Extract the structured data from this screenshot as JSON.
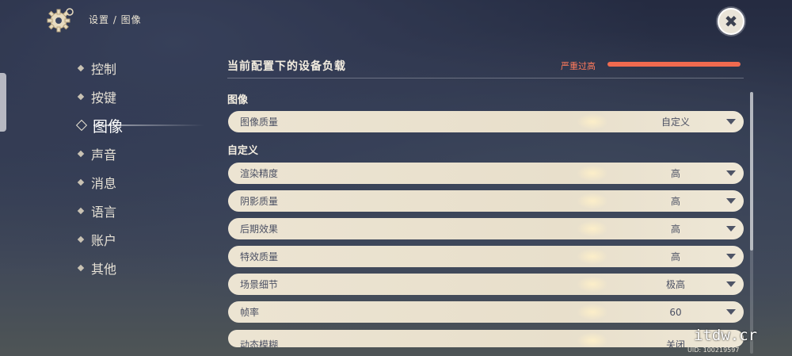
{
  "header": {
    "breadcrumb": "设置 / 图像",
    "settings_icon": "gear-icon",
    "close_icon": "close-icon"
  },
  "nav": {
    "items": [
      {
        "label": "控制",
        "active": false
      },
      {
        "label": "按键",
        "active": false
      },
      {
        "label": "图像",
        "active": true
      },
      {
        "label": "声音",
        "active": false
      },
      {
        "label": "消息",
        "active": false
      },
      {
        "label": "语言",
        "active": false
      },
      {
        "label": "账户",
        "active": false
      },
      {
        "label": "其他",
        "active": false
      }
    ]
  },
  "load": {
    "title": "当前配置下的设备负载",
    "status": "严重过高",
    "status_color": "#ff7a5c",
    "level": 1.0
  },
  "sections": {
    "image": "图像",
    "custom": "自定义"
  },
  "settings": {
    "quality": {
      "label": "图像质量",
      "value": "自定义"
    },
    "render": {
      "label": "渲染精度",
      "value": "高"
    },
    "shadow": {
      "label": "阴影质量",
      "value": "高"
    },
    "post": {
      "label": "后期效果",
      "value": "高"
    },
    "effects": {
      "label": "特效质量",
      "value": "高"
    },
    "scene": {
      "label": "场景细节",
      "value": "极高"
    },
    "fps": {
      "label": "帧率",
      "value": "60"
    },
    "motion_blur": {
      "label": "动态模糊",
      "value": "关闭"
    }
  },
  "footer": {
    "uid": "UID: 100219597",
    "watermark": "itdw.cr"
  }
}
